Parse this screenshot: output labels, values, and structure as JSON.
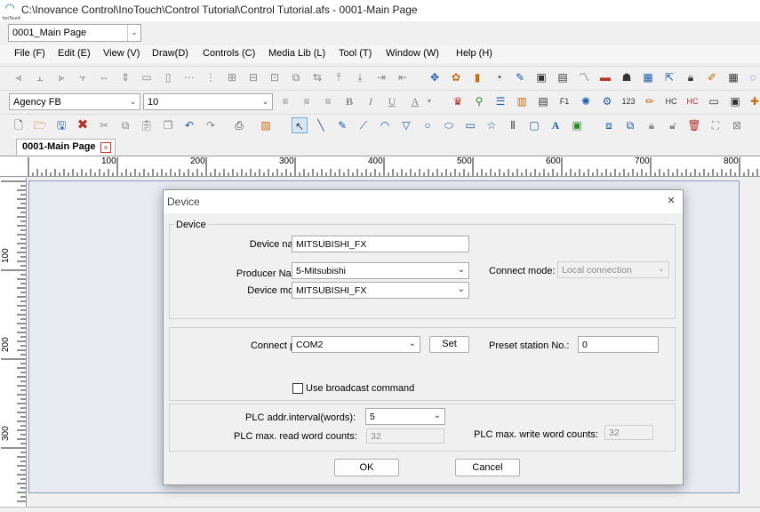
{
  "window": {
    "title": "C:\\Inovance Control\\InoTouch\\Control Tutorial\\Control Tutorial.afs - 0001-Main Page",
    "logo_text": "InoTouch"
  },
  "page_selector": {
    "value": "0001_Main Page"
  },
  "menu": [
    "File (F)",
    "Edit (E)",
    "View (V)",
    "Draw(D)",
    "Controls (C)",
    "Media Lib (L)",
    "Tool (T)",
    "Window (W)",
    "Help (H)"
  ],
  "format_bar": {
    "font": "Agency FB",
    "size": "10"
  },
  "tab": {
    "label": "0001-Main Page",
    "close": "×"
  },
  "ruler": {
    "h_labels": [
      "100",
      "200",
      "300",
      "400",
      "500",
      "600",
      "700",
      "800"
    ],
    "v_labels": [
      "100",
      "200",
      "300"
    ]
  },
  "dialog": {
    "title": "Device",
    "close": "×",
    "group_label": "Device",
    "device_name_label": "Device name:",
    "device_name": "MITSUBISHI_FX",
    "producer_label": "Producer Name:",
    "producer": "5-Mitsubishi",
    "model_label": "Device model:",
    "model": "MITSUBISHI_FX",
    "connect_mode_label": "Connect mode:",
    "connect_mode": "Local connection",
    "port_label": "Connect port:",
    "port": "COM2",
    "set_button": "Set",
    "station_label": "Preset station No.:",
    "station": "0",
    "broadcast_label": "Use broadcast command",
    "broadcast_checked": false,
    "interval_label": "PLC addr.interval(words):",
    "interval": "5",
    "max_read_label": "PLC max. read word counts:",
    "max_read": "32",
    "max_write_label": "PLC max. write word counts:",
    "max_write": "32",
    "ok_button": "OK",
    "cancel_button": "Cancel"
  }
}
